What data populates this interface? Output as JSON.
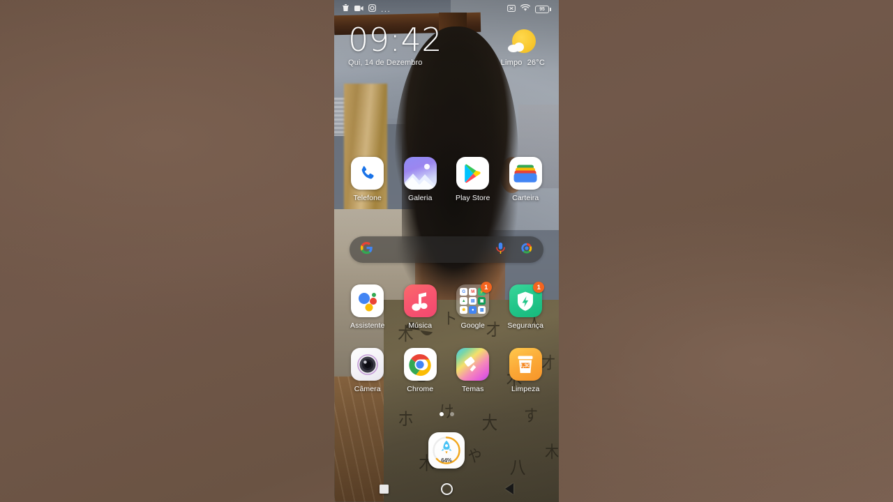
{
  "statusbar": {
    "left_icons": [
      {
        "name": "trash-icon",
        "label": "trash"
      },
      {
        "name": "video-recorder-icon",
        "label": "video recorder"
      },
      {
        "name": "screen-capture-icon",
        "label": "screen capture"
      },
      {
        "name": "more-options-icon",
        "label": "..."
      }
    ],
    "right_icons": [
      {
        "name": "no-sim-icon",
        "label": "x"
      },
      {
        "name": "wifi-icon",
        "label": "wifi"
      }
    ],
    "battery_percent": "95"
  },
  "clock_widget": {
    "time": "09:42",
    "date": "Qui, 14 de Dezembro",
    "weather_condition": "Limpo",
    "weather_temperature": "26°C",
    "weather_icon": "sun-behind-cloud-icon"
  },
  "search_bar": {
    "placeholder": "",
    "value": "",
    "google_logo": "google-g-icon",
    "mic_icon": "microphone-icon",
    "lens_icon": "google-lens-icon"
  },
  "rows": {
    "row1": [
      {
        "label": "Telefone",
        "icon": "phone-icon",
        "badge": ""
      },
      {
        "label": "Galeria",
        "icon": "gallery-icon",
        "badge": ""
      },
      {
        "label": "Play Store",
        "icon": "play-store-icon",
        "badge": ""
      },
      {
        "label": "Carteira",
        "icon": "wallet-icon",
        "badge": ""
      }
    ],
    "row2": [
      {
        "label": "Assistente",
        "icon": "google-assistant-icon",
        "badge": ""
      },
      {
        "label": "Música",
        "icon": "music-icon",
        "badge": ""
      },
      {
        "label": "Google",
        "icon": "google-folder-icon",
        "badge": "1"
      },
      {
        "label": "Segurança",
        "icon": "security-shield-icon",
        "badge": "1"
      }
    ],
    "row3": [
      {
        "label": "Câmera",
        "icon": "camera-icon",
        "badge": ""
      },
      {
        "label": "Chrome",
        "icon": "chrome-icon",
        "badge": ""
      },
      {
        "label": "Temas",
        "icon": "themes-icon",
        "badge": ""
      },
      {
        "label": "Limpeza",
        "icon": "cleaner-icon",
        "badge": ""
      }
    ]
  },
  "folder_contents": [
    "G",
    "M",
    "",
    "",
    "",
    "",
    "",
    "",
    ""
  ],
  "cleaner_icon_text": "1,3G",
  "page_indicator": {
    "total": 2,
    "active": 1
  },
  "dock": {
    "booster_percent": "64%",
    "booster_icon": "rocket-icon"
  },
  "navbar": {
    "recents_label": "Recents",
    "home_label": "Home",
    "back_label": "Back"
  },
  "colors": {
    "badge_orange": "#f4641e",
    "booster_ring": "#f2a71b",
    "security_green": "#22c68a",
    "letterbox_brown": "#6d5546"
  }
}
